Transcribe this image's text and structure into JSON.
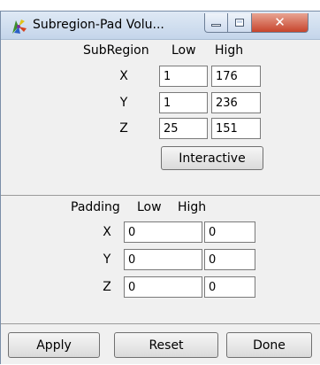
{
  "window": {
    "title": "Subregion-Pad Volu..."
  },
  "subregion": {
    "header": "SubRegion",
    "low_label": "Low",
    "high_label": "High",
    "rows": [
      {
        "axis": "X",
        "low": "1",
        "high": "176"
      },
      {
        "axis": "Y",
        "low": "1",
        "high": "236"
      },
      {
        "axis": "Z",
        "low": "25",
        "high": "151"
      }
    ],
    "interactive_label": "Interactive"
  },
  "padding": {
    "header": "Padding",
    "low_label": "Low",
    "high_label": "High",
    "rows": [
      {
        "axis": "X",
        "low": "0",
        "high": "0"
      },
      {
        "axis": "Y",
        "low": "0",
        "high": "0"
      },
      {
        "axis": "Z",
        "low": "0",
        "high": "0"
      }
    ]
  },
  "buttons": {
    "apply": "Apply",
    "reset": "Reset",
    "done": "Done"
  },
  "icons": {
    "app": "app-colorful-pinwheel-icon",
    "minimize": "minimize-icon",
    "maximize": "maximize-icon",
    "close": "close-icon"
  },
  "colors": {
    "titlebar": "#c4d5ea",
    "close_button": "#c7442c",
    "window_bg": "#f0f0f0"
  }
}
